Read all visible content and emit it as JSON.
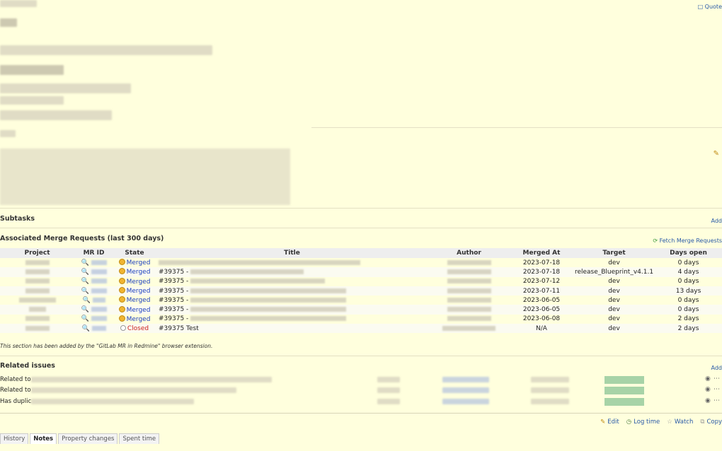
{
  "top_right": {
    "quote_label": "Quote"
  },
  "sections": {
    "subtasks_title": "Subtasks",
    "add_label": "Add",
    "merge_requests_title": "Associated Merge Requests (last 300 days)",
    "fetch_label": "Fetch Merge Requests",
    "footnote": "This section has been added by the \"GitLab MR in Redmine\" browser extension.",
    "related_title": "Related issues",
    "related_add_label": "Add"
  },
  "table": {
    "headers": [
      "Project",
      "MR ID",
      "State",
      "Title",
      "Author",
      "Merged At",
      "Target",
      "Days open"
    ],
    "rows": [
      {
        "state": "Merged",
        "title": "",
        "merged_at": "2023-07-18",
        "target": "dev",
        "days": "0 days"
      },
      {
        "state": "Merged",
        "title": "#39375 -",
        "merged_at": "2023-07-18",
        "target": "release_Blueprint_v4.1.1",
        "days": "4 days"
      },
      {
        "state": "Merged",
        "title": "#39375 -",
        "merged_at": "2023-07-12",
        "target": "dev",
        "days": "0 days"
      },
      {
        "state": "Merged",
        "title": "#39375 -",
        "merged_at": "2023-07-11",
        "target": "dev",
        "days": "13 days"
      },
      {
        "state": "Merged",
        "title": "#39375 -",
        "merged_at": "2023-06-05",
        "target": "dev",
        "days": "0 days"
      },
      {
        "state": "Merged",
        "title": "#39375 -",
        "merged_at": "2023-06-05",
        "target": "dev",
        "days": "0 days"
      },
      {
        "state": "Merged",
        "title": "#39375 -",
        "merged_at": "2023-06-08",
        "target": "dev",
        "days": "2 days"
      },
      {
        "state": "Closed",
        "title": "#39375 Test",
        "merged_at": "N/A",
        "target": "dev",
        "days": "2 days"
      }
    ]
  },
  "related": [
    {
      "label": "Related to"
    },
    {
      "label": "Related to"
    },
    {
      "label": "Has duplic"
    }
  ],
  "actions": [
    "Edit",
    "Log time",
    "Watch",
    "Copy"
  ],
  "tabs": [
    "History",
    "Notes",
    "Property changes",
    "Spent time"
  ],
  "colors": {
    "background": "#ffffdd",
    "merged": "#1c3fbf",
    "closed": "#cc2222",
    "status_bar": "#a7d3a7"
  }
}
